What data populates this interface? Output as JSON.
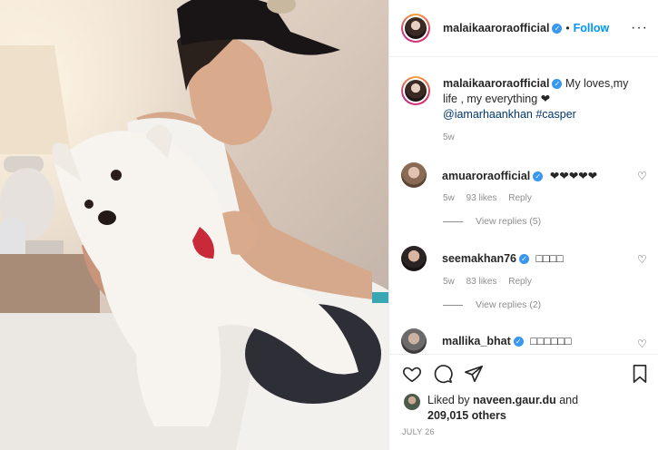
{
  "header": {
    "username": "malaikaaroraofficial",
    "separator": "•",
    "follow_label": "Follow",
    "more_label": "···"
  },
  "caption": {
    "username": "malaikaaroraofficial",
    "text": "My loves,my life , my everything ❤",
    "mention": "@iamarhaankhan",
    "hashtag": "#casper",
    "time": "5w"
  },
  "comments": [
    {
      "username": "amuaroraofficial",
      "text": "❤❤❤❤❤",
      "time": "5w",
      "likes": "93 likes",
      "reply": "Reply",
      "replies": "View replies (5)",
      "verified": true
    },
    {
      "username": "seemakhan76",
      "text": "□□□□",
      "time": "5w",
      "likes": "83 likes",
      "reply": "Reply",
      "replies": "View replies (2)",
      "verified": true
    },
    {
      "username": "mallika_bhat",
      "text": "□□□□□□",
      "verified": true
    }
  ],
  "likes": {
    "prefix": "Liked by",
    "user": "naveen.gaur.du",
    "suffix": "and",
    "others": "209,015 others"
  },
  "date": "JULY 26",
  "icons": {
    "like": "heart-icon",
    "comment": "comment-icon",
    "share": "share-icon",
    "save": "bookmark-icon",
    "verified": "verified-badge-icon"
  },
  "colors": {
    "follow": "#0095f6",
    "link": "#00376b",
    "verified": "#3897f0",
    "muted": "#8e8e8e"
  }
}
